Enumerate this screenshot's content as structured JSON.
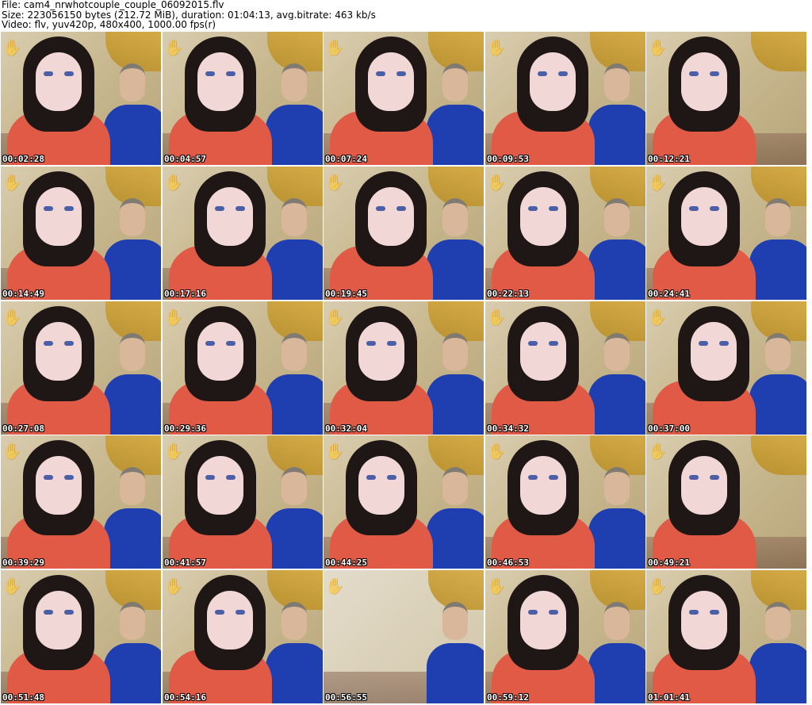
{
  "header": {
    "file_line": "File: cam4_nrwhotcouple_couple_06092015.flv",
    "size_line": "Size: 223056150 bytes (212.72 MiB), duration: 01:04:13, avg.bitrate: 463 kb/s",
    "video_line": "Video: flv, yuv420p, 480x400, 1000.00 fps(r)"
  },
  "thumbnails": [
    {
      "timestamp": "00:02:28",
      "variant": ""
    },
    {
      "timestamp": "00:04:57",
      "variant": ""
    },
    {
      "timestamp": "00:07:24",
      "variant": "variant-b"
    },
    {
      "timestamp": "00:09:53",
      "variant": "variant-b"
    },
    {
      "timestamp": "00:12:21",
      "variant": "variant-c"
    },
    {
      "timestamp": "00:14:49",
      "variant": ""
    },
    {
      "timestamp": "00:17:16",
      "variant": "variant-b"
    },
    {
      "timestamp": "00:19:45",
      "variant": "variant-b"
    },
    {
      "timestamp": "00:22:13",
      "variant": ""
    },
    {
      "timestamp": "00:24:41",
      "variant": ""
    },
    {
      "timestamp": "00:27:08",
      "variant": ""
    },
    {
      "timestamp": "00:29:36",
      "variant": ""
    },
    {
      "timestamp": "00:32:04",
      "variant": ""
    },
    {
      "timestamp": "00:34:32",
      "variant": ""
    },
    {
      "timestamp": "00:37:00",
      "variant": "variant-b"
    },
    {
      "timestamp": "00:39:29",
      "variant": ""
    },
    {
      "timestamp": "00:41:57",
      "variant": ""
    },
    {
      "timestamp": "00:44:25",
      "variant": ""
    },
    {
      "timestamp": "00:46:53",
      "variant": ""
    },
    {
      "timestamp": "00:49:21",
      "variant": "variant-c"
    },
    {
      "timestamp": "00:51:48",
      "variant": ""
    },
    {
      "timestamp": "00:54:16",
      "variant": "variant-b"
    },
    {
      "timestamp": "00:56:55",
      "variant": "variant-d"
    },
    {
      "timestamp": "00:59:12",
      "variant": ""
    },
    {
      "timestamp": "01:01:41",
      "variant": ""
    }
  ],
  "colors": {
    "background": "#ffffff",
    "header_text": "#000000",
    "timestamp_text": "#ffffff",
    "timestamp_outline": "#000000"
  }
}
